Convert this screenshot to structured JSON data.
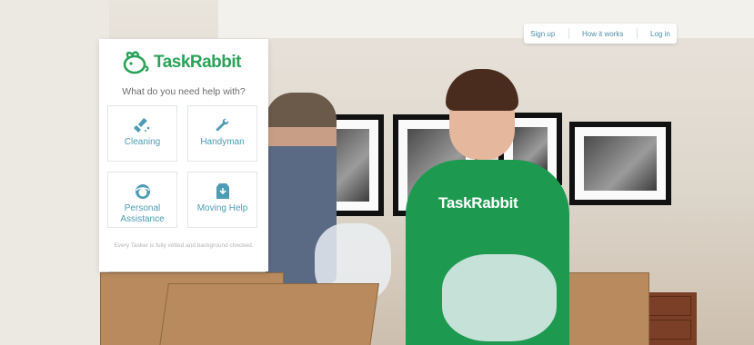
{
  "nav": {
    "signup": "Sign up",
    "how": "How it works",
    "login": "Log in"
  },
  "brand": {
    "name": "TaskRabbit",
    "shirt_text": "TaskRabbit",
    "color": "#2aa258"
  },
  "panel": {
    "question": "What do you need help with?",
    "tiles": [
      {
        "label": "Cleaning",
        "icon": "cleaning-icon"
      },
      {
        "label": "Handyman",
        "icon": "wrench-icon"
      },
      {
        "label": "Personal Assistance",
        "icon": "assistant-icon"
      },
      {
        "label": "Moving Help",
        "icon": "box-icon"
      }
    ],
    "footnote": "Every Tasker is fully vetted and background checked."
  }
}
